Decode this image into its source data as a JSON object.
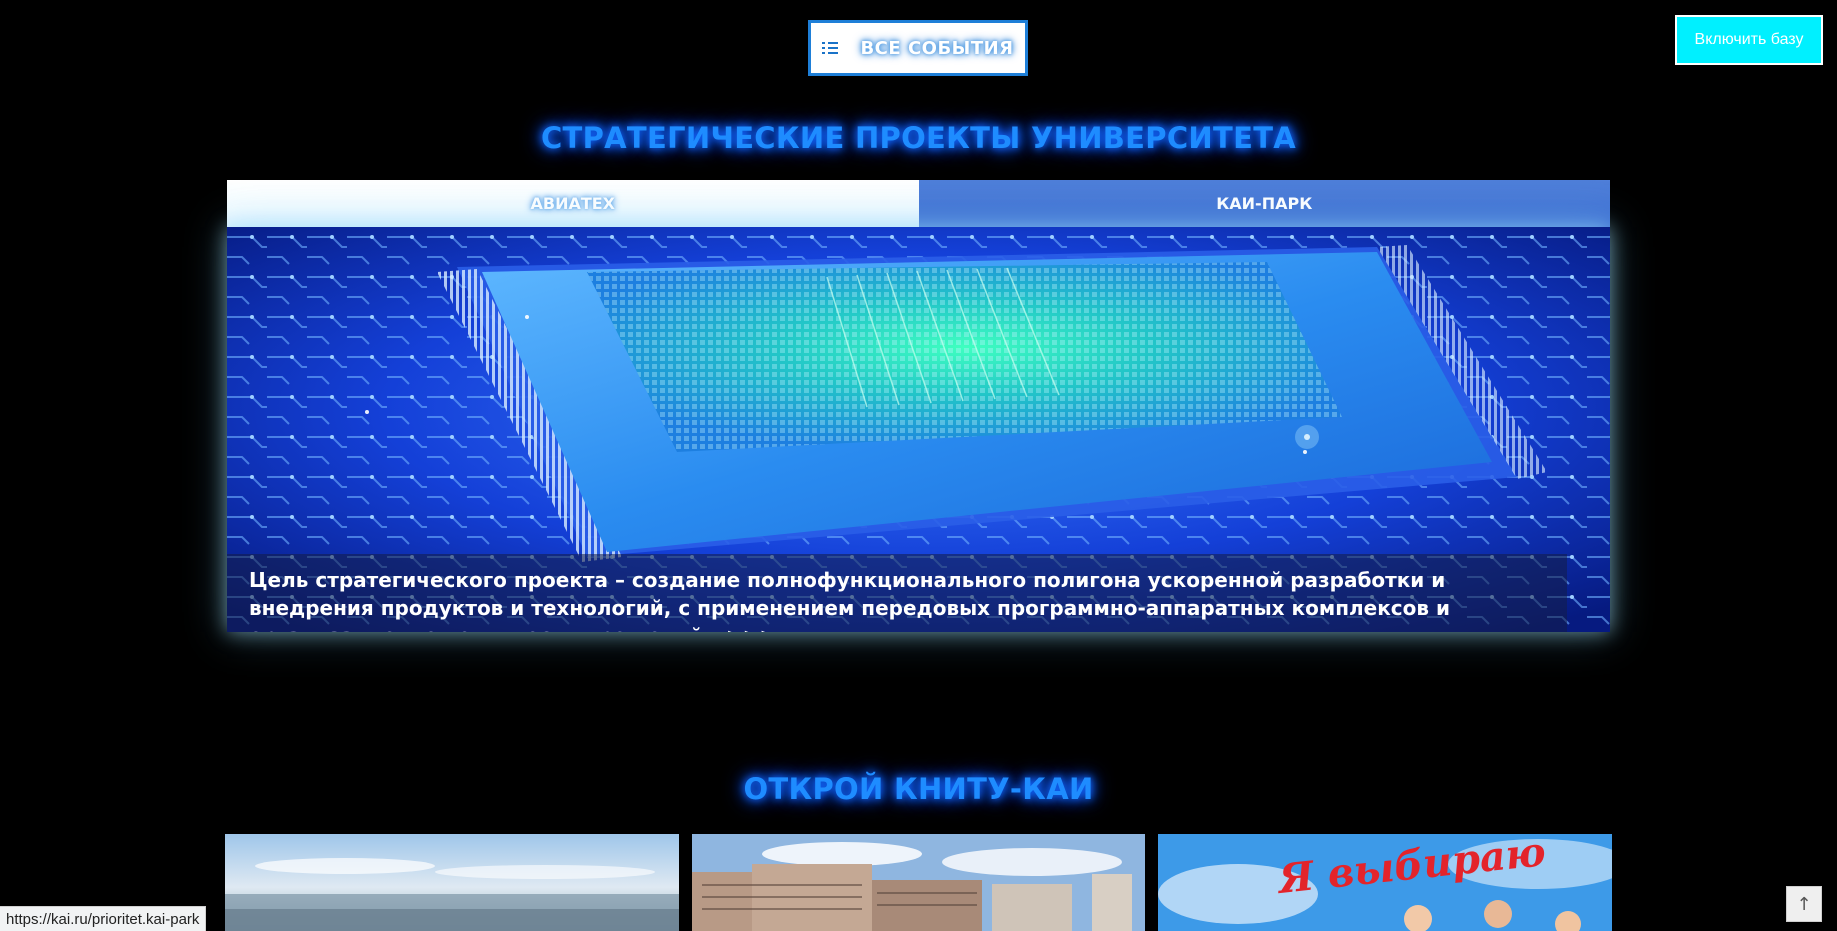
{
  "header": {
    "events_button_label": "ВСЕ СОБЫТИЯ",
    "events_icon": "list-icon",
    "base_button_label": "Включить базу"
  },
  "strategic": {
    "title": "СТРАТЕГИЧЕСКИЕ ПРОЕКТЫ УНИВЕРСИТЕТА",
    "tabs": [
      {
        "label": "АВИАТЕХ",
        "active": true
      },
      {
        "label": "КАИ-ПАРК",
        "active": false
      }
    ],
    "slide_caption": "Цель стратегического проекта – создание полнофункционального полигона ускоренной разработки и внедрения продуктов и технологий, с применением передовых программно-аппаратных комплексов и организационно-технических решений...>>>"
  },
  "open_section": {
    "title": "ОТКРОЙ КНИТУ-КАИ",
    "cards": [
      {
        "image": "city-panorama-photo"
      },
      {
        "image": "campus-buildings-photo"
      },
      {
        "image": "students-photo",
        "overlay_text": "Я выбираю"
      }
    ]
  },
  "status_bar": {
    "url": "https://kai.ru/prioritet.kai-park"
  },
  "scroll_top": {
    "glyph": "↑"
  },
  "colors": {
    "background": "#000000",
    "heading_blue": "#1e8cff",
    "tab_inactive": "#4877d6",
    "base_button": "#00f0ff"
  }
}
